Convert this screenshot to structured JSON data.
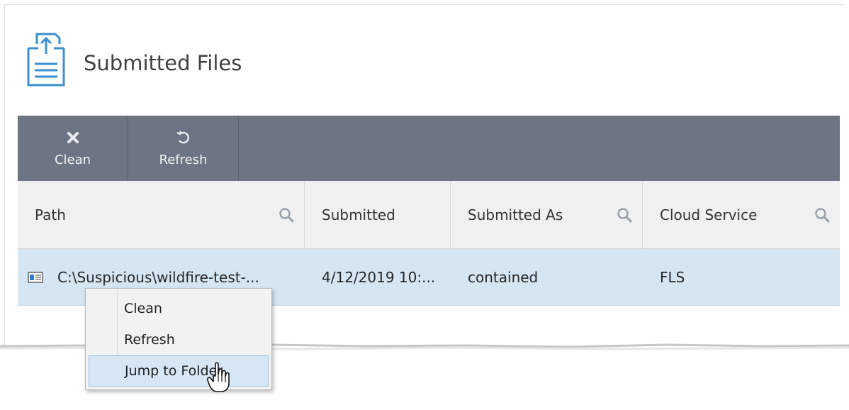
{
  "header": {
    "title": "Submitted Files",
    "icon": "document-upload-icon"
  },
  "toolbar": {
    "clean_label": "Clean",
    "refresh_label": "Refresh"
  },
  "table": {
    "columns": [
      {
        "label": "Path",
        "searchable": true
      },
      {
        "label": "Submitted",
        "searchable": false
      },
      {
        "label": "Submitted As",
        "searchable": true
      },
      {
        "label": "Cloud Service",
        "searchable": true
      }
    ],
    "rows": [
      {
        "path": "C:\\Suspicious\\wildfire-test-...",
        "submitted": "4/12/2019 10:...",
        "submitted_as": "contained",
        "cloud_service": "FLS"
      }
    ]
  },
  "context_menu": {
    "items": [
      {
        "label": "Clean"
      },
      {
        "label": "Refresh"
      },
      {
        "label": "Jump to Folder",
        "highlighted": true
      }
    ]
  },
  "colors": {
    "toolbar_bg": "#6d7483",
    "selected_row_bg": "#d5e5f2",
    "header_bg": "#f0f0f0",
    "accent_icon": "#3a8fd0"
  }
}
